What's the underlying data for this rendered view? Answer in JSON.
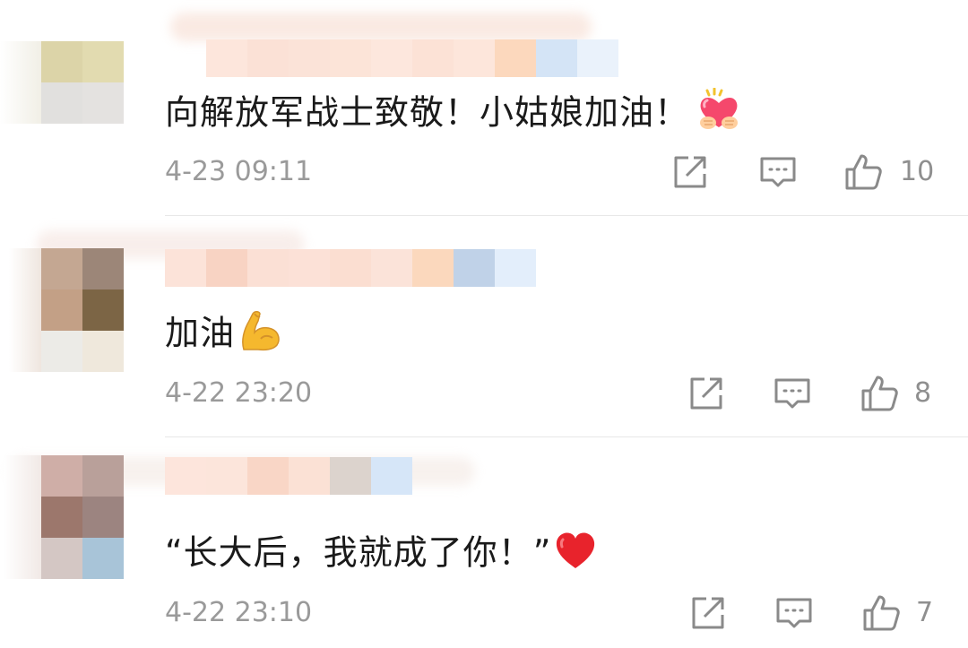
{
  "comments": [
    {
      "text": "向解放军战士致敬！小姑娘加油！",
      "emoji": "heart-hands",
      "time": "4-23 09:11",
      "likes": "10"
    },
    {
      "text": "加油",
      "emoji": "flexed-biceps",
      "time": "4-22 23:20",
      "likes": "8"
    },
    {
      "text": "“长大后，我就成了你！”",
      "emoji": "red-heart",
      "time": "4-22 23:10",
      "likes": "7"
    }
  ],
  "icons": {
    "share": "share-icon",
    "reply": "reply-icon",
    "like": "thumbs-up-icon"
  },
  "colors": {
    "text": "#1a1a1a",
    "meta": "#9a9a9a",
    "icon": "#8a8a8a",
    "divider": "#e8e8e8",
    "heart": "#e8232c"
  }
}
